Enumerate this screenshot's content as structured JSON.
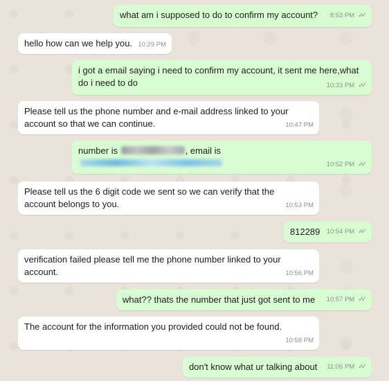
{
  "messages": [
    {
      "dir": "out",
      "text": "what am i supposed to do to confirm my account?",
      "time": "8:53 PM"
    },
    {
      "dir": "in",
      "text": "hello how can we help you.",
      "time": "10:29 PM"
    },
    {
      "dir": "out",
      "text": "i got a email saying i need to confirm my account, it sent me here,what do i need to do",
      "time": "10:33 PM"
    },
    {
      "dir": "in",
      "text": "Please tell us the phone number and e-mail address linked to your account so that we can continue.",
      "time": "10:47 PM"
    },
    {
      "dir": "out",
      "text_a": "number is",
      "text_b": ", email is",
      "time": "10:52 PM"
    },
    {
      "dir": "in",
      "text": "Please tell us the 6 digit code we sent so we can verify that the account belongs to you.",
      "time": "10:53 PM"
    },
    {
      "dir": "out",
      "text": "812289",
      "time": "10:54 PM"
    },
    {
      "dir": "in",
      "text": "verification failed please tell me the phone number linked to your account.",
      "time": "10:56 PM"
    },
    {
      "dir": "out",
      "text": "what?? thats the number that just got sent to me",
      "time": "10:57 PM"
    },
    {
      "dir": "in",
      "text": "The account for the information you provided could not be found.",
      "time": "10:58 PM"
    },
    {
      "dir": "out",
      "text": "don't know what ur talking about",
      "time": "11:06 PM"
    }
  ],
  "icons": {
    "read_receipt": "double-check-icon"
  },
  "colors": {
    "outgoing": "#d9fdd3",
    "incoming": "#ffffff",
    "background": "#e9e3da"
  }
}
